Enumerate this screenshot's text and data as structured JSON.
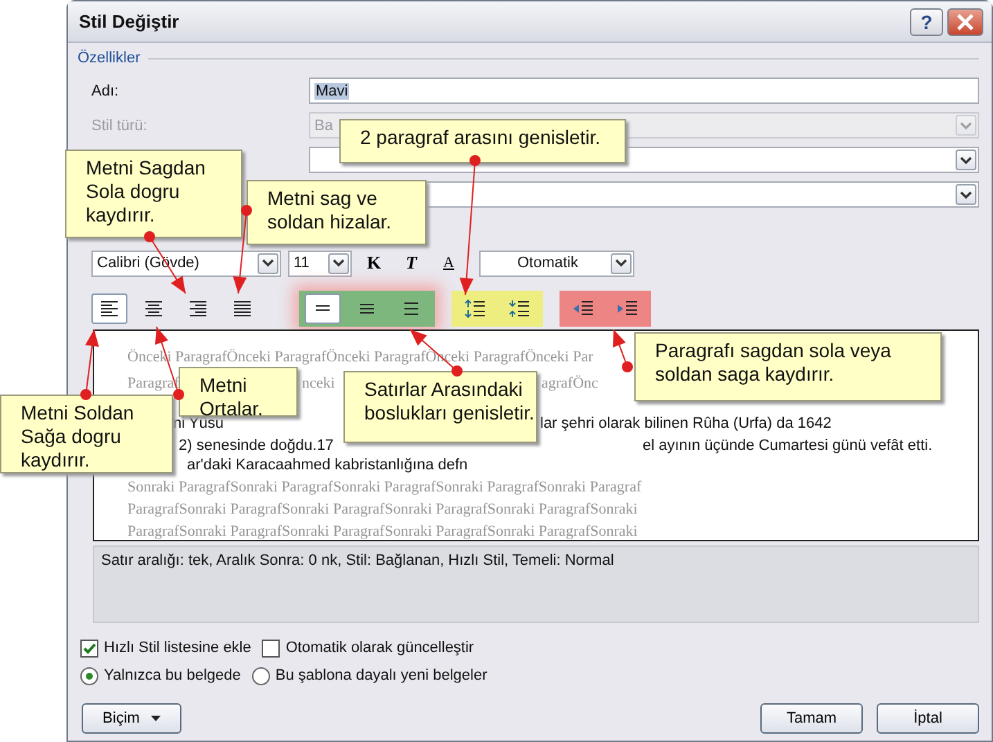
{
  "window": {
    "title": "Stil Değiştir",
    "help_label": "?"
  },
  "properties": {
    "heading": "Özellikler",
    "fields": [
      {
        "kind": "text",
        "label": "Adı:",
        "value": "Mavi",
        "disabled": false
      },
      {
        "kind": "select",
        "label": "Stil türü:",
        "value": "Ba",
        "disabled": true
      },
      {
        "kind": "select",
        "disabled": false
      },
      {
        "kind": "select",
        "disabled": false
      }
    ]
  },
  "formatting": {
    "font": "Calibri (Gövde)",
    "size": "11",
    "bold_label": "K",
    "italic_label": "T",
    "underline_label": "A",
    "text_color_choice": "Otomatik"
  },
  "alignment": [
    {
      "kind": "left",
      "selected": true
    },
    {
      "kind": "center",
      "selected": false
    },
    {
      "kind": "right",
      "selected": false
    },
    {
      "kind": "justify",
      "selected": false
    }
  ],
  "button_groups": [
    {
      "color": "#7db77d",
      "buttons": [
        {
          "kind": "single",
          "selected": true
        },
        {
          "kind": "onehalf",
          "selected": false
        },
        {
          "kind": "double",
          "selected": false
        }
      ]
    },
    {
      "color": "#eeee80",
      "buttons": [
        {
          "kind": "spread-up",
          "selected": false
        },
        {
          "kind": "spread-down",
          "selected": false
        }
      ]
    },
    {
      "color": "#ee8585",
      "buttons": [
        {
          "kind": "rtl",
          "selected": false
        },
        {
          "kind": "ltr",
          "selected": false
        }
      ]
    }
  ],
  "preview": {
    "rows": [
      {
        "kind": "previous",
        "segments": [
          "Önceki ParagrafÖnceki ParagrafÖnceki ParagrafÖnceki ParagrafÖnceki Par"
        ]
      },
      {
        "kind": "previous",
        "segments": [
          "Paragraf",
          "nceki",
          "agrafÖnc"
        ]
      },
      {
        "kind": "body",
        "segments": [
          "ni Yûsu",
          "lar şehri olarak bilinen Rûha (Urfa) da 1642"
        ]
      },
      {
        "kind": "body",
        "segments": [
          "2) senesinde doğdu.17",
          "el ayının üçünde Cumartesi günü vefât etti."
        ]
      },
      {
        "kind": "body",
        "segments": [
          "ar'daki Karacaahmed kabristanlığına defn"
        ]
      },
      {
        "kind": "next",
        "segments": [
          "Sonraki ParagrafSonraki ParagrafSonraki ParagrafSonraki ParagrafSonraki Paragraf"
        ]
      },
      {
        "kind": "next",
        "segments": [
          "ParagrafSonraki ParagrafSonraki ParagrafSonraki ParagrafSonraki ParagrafSonraki"
        ]
      },
      {
        "kind": "next",
        "segments": [
          "ParagrafSonraki ParagrafSonraki ParagrafSonraki ParagrafSonraki ParagrafSonraki"
        ]
      }
    ]
  },
  "description": "Satır aralığı:  tek, Aralık Sonra:  0 nk, Stil: Bağlanan, Hızlı Stil, Temeli: Normal",
  "options": [
    {
      "label": "Hızlı Stil listesine ekle",
      "checked": true
    },
    {
      "label": "Otomatik olarak güncelleştir",
      "checked": false
    }
  ],
  "scope": [
    {
      "label": "Yalnızca bu belgede",
      "selected": true
    },
    {
      "label": "Bu şablona dayalı yeni belgeler",
      "selected": false
    }
  ],
  "buttons": {
    "format": "Biçim",
    "ok": "Tamam",
    "cancel": "İptal"
  },
  "callouts": [
    {
      "text": "Metni Sagdan\nSola dogru\nkaydırır."
    },
    {
      "text": "Metni sag ve\nsoldan hizalar."
    },
    {
      "text": "2 paragraf arasını genisletir."
    },
    {
      "text": "Metni Soldan\nSağa dogru\nkaydırır."
    },
    {
      "text": "Metni\nOrtalar."
    },
    {
      "text": "Satırlar Arasındaki\nboslukları genisletir."
    },
    {
      "text": "Paragrafı sagdan sola veya\nsoldan saga kaydırır."
    }
  ]
}
